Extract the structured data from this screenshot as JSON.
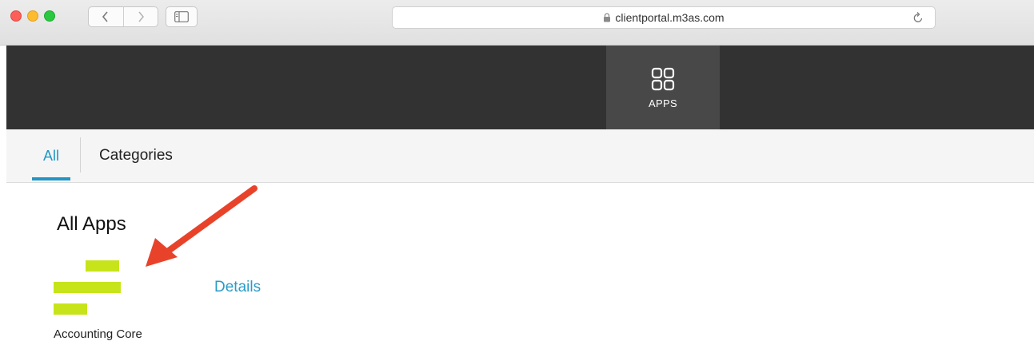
{
  "browser": {
    "url": "clientportal.m3as.com",
    "icons": [
      "close-window-icon",
      "minimize-window-icon",
      "zoom-window-icon",
      "back-icon",
      "forward-icon",
      "sidebar-icon",
      "lock-icon",
      "reload-icon"
    ]
  },
  "header": {
    "apps_label": "APPS",
    "icons": [
      "apps-grid-icon"
    ]
  },
  "tabs": [
    {
      "label": "All",
      "active": true
    },
    {
      "label": "Categories",
      "active": false
    }
  ],
  "main": {
    "section_title": "All Apps",
    "apps": [
      {
        "name": "Accounting Core",
        "details_label": "Details"
      }
    ]
  },
  "colors": {
    "accent": "#2196c4",
    "header_bg": "#323232",
    "apps_tab_bg": "#484848",
    "logo_green": "#c7e41a",
    "annotation_arrow": "#e8432a"
  }
}
